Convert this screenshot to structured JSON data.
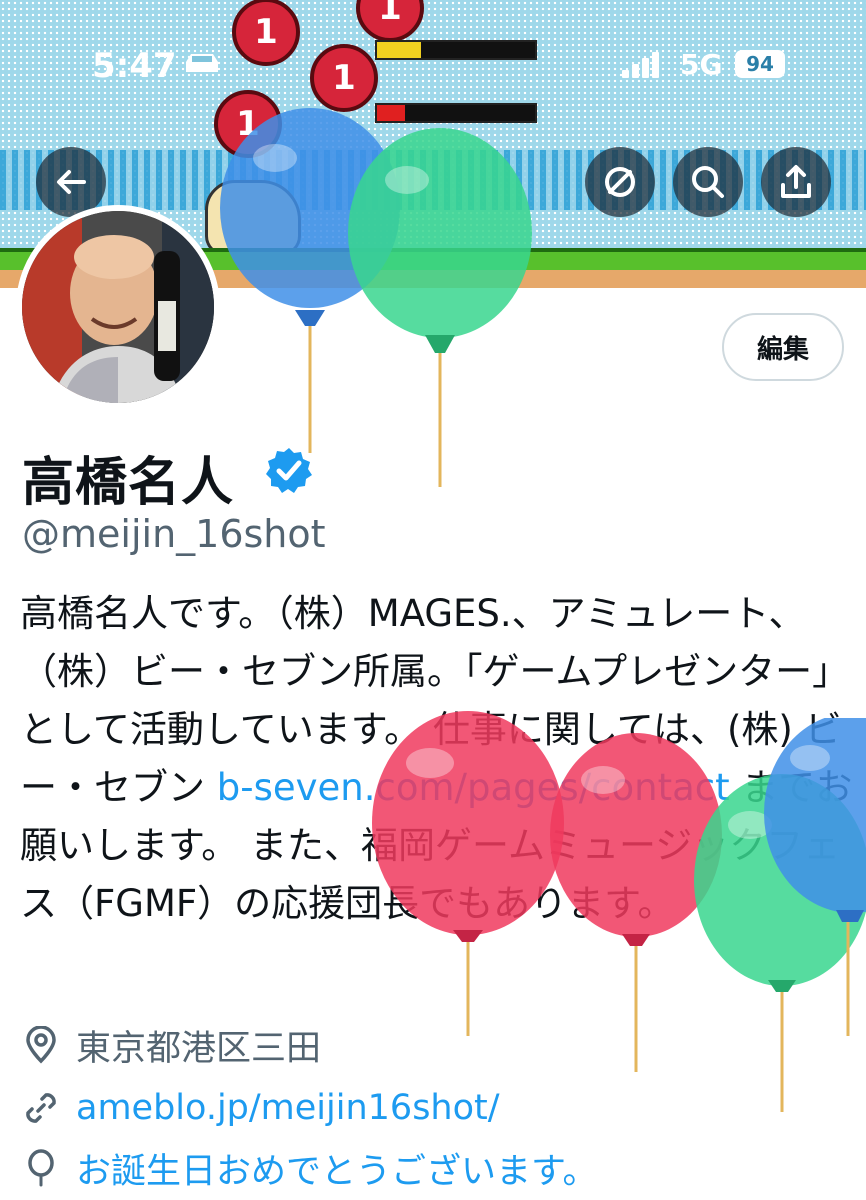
{
  "status_bar": {
    "time": "5:47",
    "network": "5G",
    "battery": "94"
  },
  "banner": {
    "token_label": "1"
  },
  "profile": {
    "display_name": "高橋名人",
    "handle": "@meijin_16shot",
    "edit_button": "編集",
    "bio": {
      "part1": "高橋名人です。（株）MAGES.、アミュレート、（株）ビー・セブン所属。「ゲームプレゼンター」として活動しています。 仕事に関しては、(株) ビー・セブン ",
      "link": "b-seven.com/pages/contact",
      "part2": " までお願いします。 また、福岡ゲームミュージックフェス（FGMF）の応援団長でもあります。"
    },
    "location": "東京都港区三田",
    "website": "ameblo.jp/meijin16shot/",
    "birthday": "お誕生日おめでとうございます。"
  },
  "icons": {
    "back": "back-arrow-icon",
    "circle": "circle-slash-icon",
    "search": "search-icon",
    "share": "share-icon",
    "verified": "verified-badge-icon",
    "location": "location-pin-icon",
    "link": "link-icon",
    "birthday": "balloon-icon"
  },
  "colors": {
    "accent": "#1d9bf0",
    "muted": "#536471"
  }
}
